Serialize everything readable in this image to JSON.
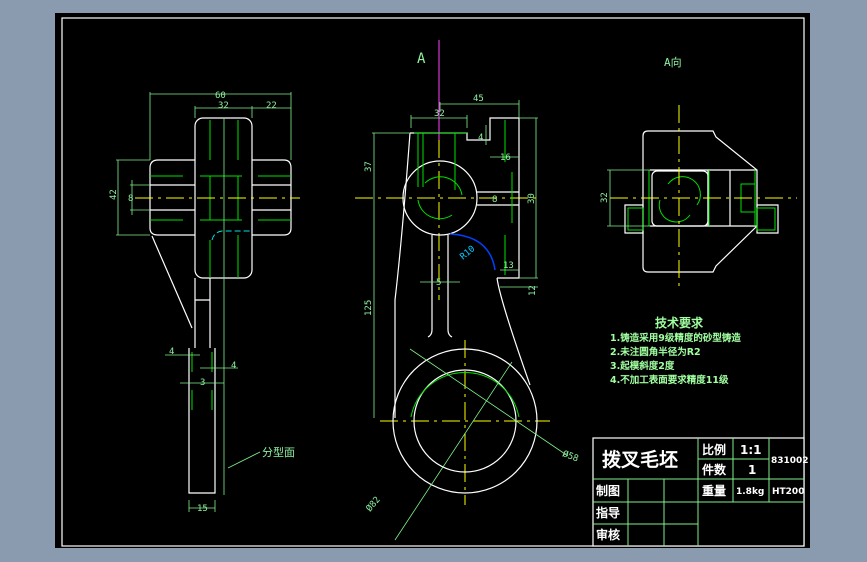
{
  "drawing": {
    "view_labels": {
      "section_a": "A",
      "view_a": "A向"
    },
    "dimensions": {
      "left_view": [
        "60",
        "32",
        "22",
        "42",
        "8",
        "4",
        "4",
        "3",
        "15"
      ],
      "main_view": [
        "45",
        "32",
        "4",
        "16",
        "37",
        "30",
        "8",
        "13",
        "12",
        "5",
        "125",
        "R10",
        "Ø58",
        "Ø82"
      ],
      "a_view": [
        "32"
      ]
    },
    "parting_label": "分型面",
    "tech_requirements": {
      "title": "技术要求",
      "items": [
        "1.铸造采用9级精度的砂型铸造",
        "2.未注圆角半径为R2",
        "3.起模斜度2度",
        "4.不加工表面要求精度11级"
      ]
    },
    "title_block": {
      "part_name": "拨叉毛坯",
      "scale_label": "比例",
      "scale_value": "1:1",
      "quantity_label": "件数",
      "quantity_value": "1",
      "drawing_number": "831002",
      "weight_label": "重量",
      "weight_value": "1.8kg",
      "material": "HT200",
      "drawn_label": "制图",
      "guide_label": "指导",
      "review_label": "审核"
    },
    "colors": {
      "background": "#000000",
      "outline": "#ffffff",
      "dimension": "#7ef08a",
      "centerline": "#ffff00",
      "hidden": "#00e000",
      "radius": "#0040ff"
    }
  }
}
